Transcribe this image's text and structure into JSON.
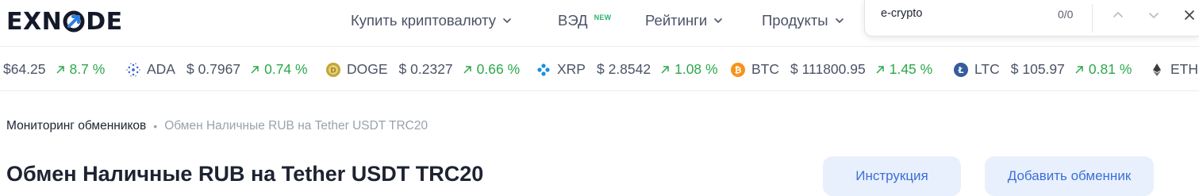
{
  "header": {
    "logo_text": "EXNODE",
    "nav": [
      {
        "label": "Купить криптовалюту",
        "has_dropdown": true
      },
      {
        "label": "ВЭД",
        "badge": "NEW"
      },
      {
        "label": "Рейтинги",
        "has_dropdown": true
      },
      {
        "label": "Продукты",
        "has_dropdown": true
      }
    ]
  },
  "findbar": {
    "query": "e-crypto",
    "count": "0/0",
    "icons": [
      "chevron-up-icon",
      "chevron-down-icon",
      "close-icon"
    ]
  },
  "ticker": [
    {
      "symbol": "",
      "price": "$64.25",
      "change": "8.7 %",
      "icon": "partial"
    },
    {
      "symbol": "ADA",
      "price": "$ 0.7967",
      "change": "0.74 %",
      "icon": "ada-icon",
      "color": "#2f5bd3"
    },
    {
      "symbol": "DOGE",
      "price": "$ 0.2327",
      "change": "0.66 %",
      "icon": "doge-icon",
      "color": "#c2a633"
    },
    {
      "symbol": "XRP",
      "price": "$ 2.8542",
      "change": "1.08 %",
      "icon": "xrp-icon",
      "color": "#1a8fe0"
    },
    {
      "symbol": "BTC",
      "price": "$ 111800.95",
      "change": "1.45 %",
      "icon": "btc-icon",
      "color": "#f7931a"
    },
    {
      "symbol": "LTC",
      "price": "$ 105.97",
      "change": "0.81 %",
      "icon": "ltc-icon",
      "color": "#345d9d"
    },
    {
      "symbol": "ETH",
      "price": "",
      "change": "",
      "icon": "eth-icon",
      "color": "#3c3c3d"
    }
  ],
  "breadcrumb": {
    "link": "Мониторинг обменников",
    "separator": "•",
    "current": "Обмен Наличные RUB на Tether USDT TRC20"
  },
  "page": {
    "title": "Обмен Наличные RUB на Tether USDT TRC20",
    "instruction_button": "Инструкция",
    "add_exchanger_button": "Добавить обменник"
  },
  "colors": {
    "positive": "#2aa84a",
    "accent": "#3b6fd8",
    "button_bg": "#e9f0fd"
  }
}
